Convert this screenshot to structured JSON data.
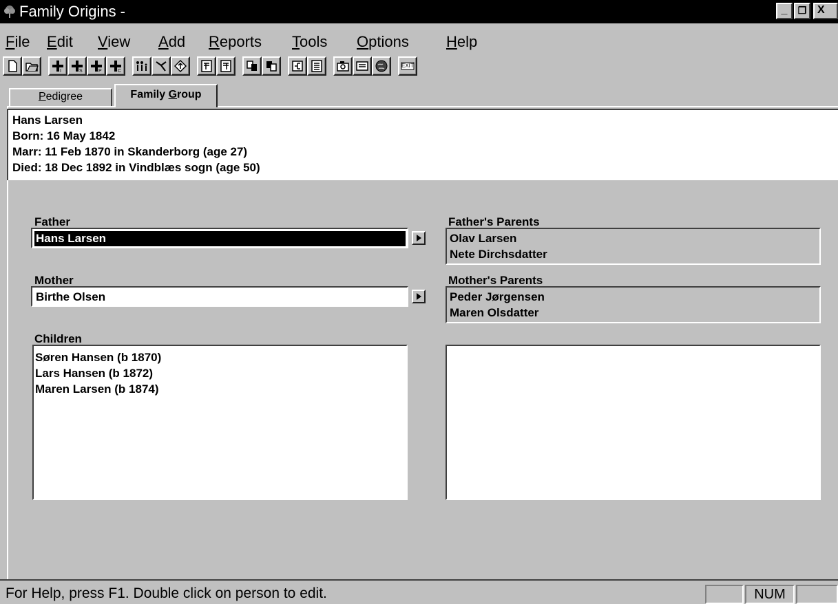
{
  "window": {
    "title": "Family Origins -",
    "controls": [
      "minimize",
      "restore",
      "close"
    ]
  },
  "menu": [
    {
      "label": "File"
    },
    {
      "label": "Edit"
    },
    {
      "label": "View"
    },
    {
      "label": "Add"
    },
    {
      "label": "Reports"
    },
    {
      "label": "Tools"
    },
    {
      "label": "Options"
    },
    {
      "label": "Help"
    }
  ],
  "toolbar": {
    "buttons": [
      "new-file-icon",
      "open-folder-icon",
      "add-individual-icon",
      "add-spouse-icon",
      "add-parents-icon",
      "add-child-icon",
      "family-icon",
      "edit-icon",
      "navigate-icon",
      "notes-icon",
      "notes2-icon",
      "report-icon",
      "report2-icon",
      "tree-icon",
      "list-icon",
      "camera-icon",
      "card-icon",
      "globe-icon",
      "exit-icon"
    ],
    "exit_label": "EXIT"
  },
  "tabs": {
    "pedigree": "Pedigree",
    "family_group": "Family Group"
  },
  "header": {
    "name": "Hans Larsen",
    "born": "Born: 16 May 1842",
    "marr": "Marr: 11 Feb 1870 in Skanderborg (age 27)",
    "died": "Died: 18 Dec 1892 in Vindblæs sogn (age 50)"
  },
  "father": {
    "label": "Father",
    "value": "Hans Larsen"
  },
  "mother": {
    "label": "Mother",
    "value": "Birthe Olsen"
  },
  "fathers_parents": {
    "label": "Father's Parents",
    "names": [
      "Olav Larsen",
      "Nete Dirchsdatter"
    ]
  },
  "mothers_parents": {
    "label": "Mother's Parents",
    "names": [
      "Peder Jørgensen",
      "Maren Olsdatter"
    ]
  },
  "children": {
    "label": "Children",
    "items": [
      "Søren Hansen  (b 1870)",
      "Lars Hansen  (b 1872)",
      "Maren Larsen  (b 1874)"
    ]
  },
  "status": {
    "text": "For Help, press F1.  Double click on person to edit.",
    "num": "NUM"
  }
}
